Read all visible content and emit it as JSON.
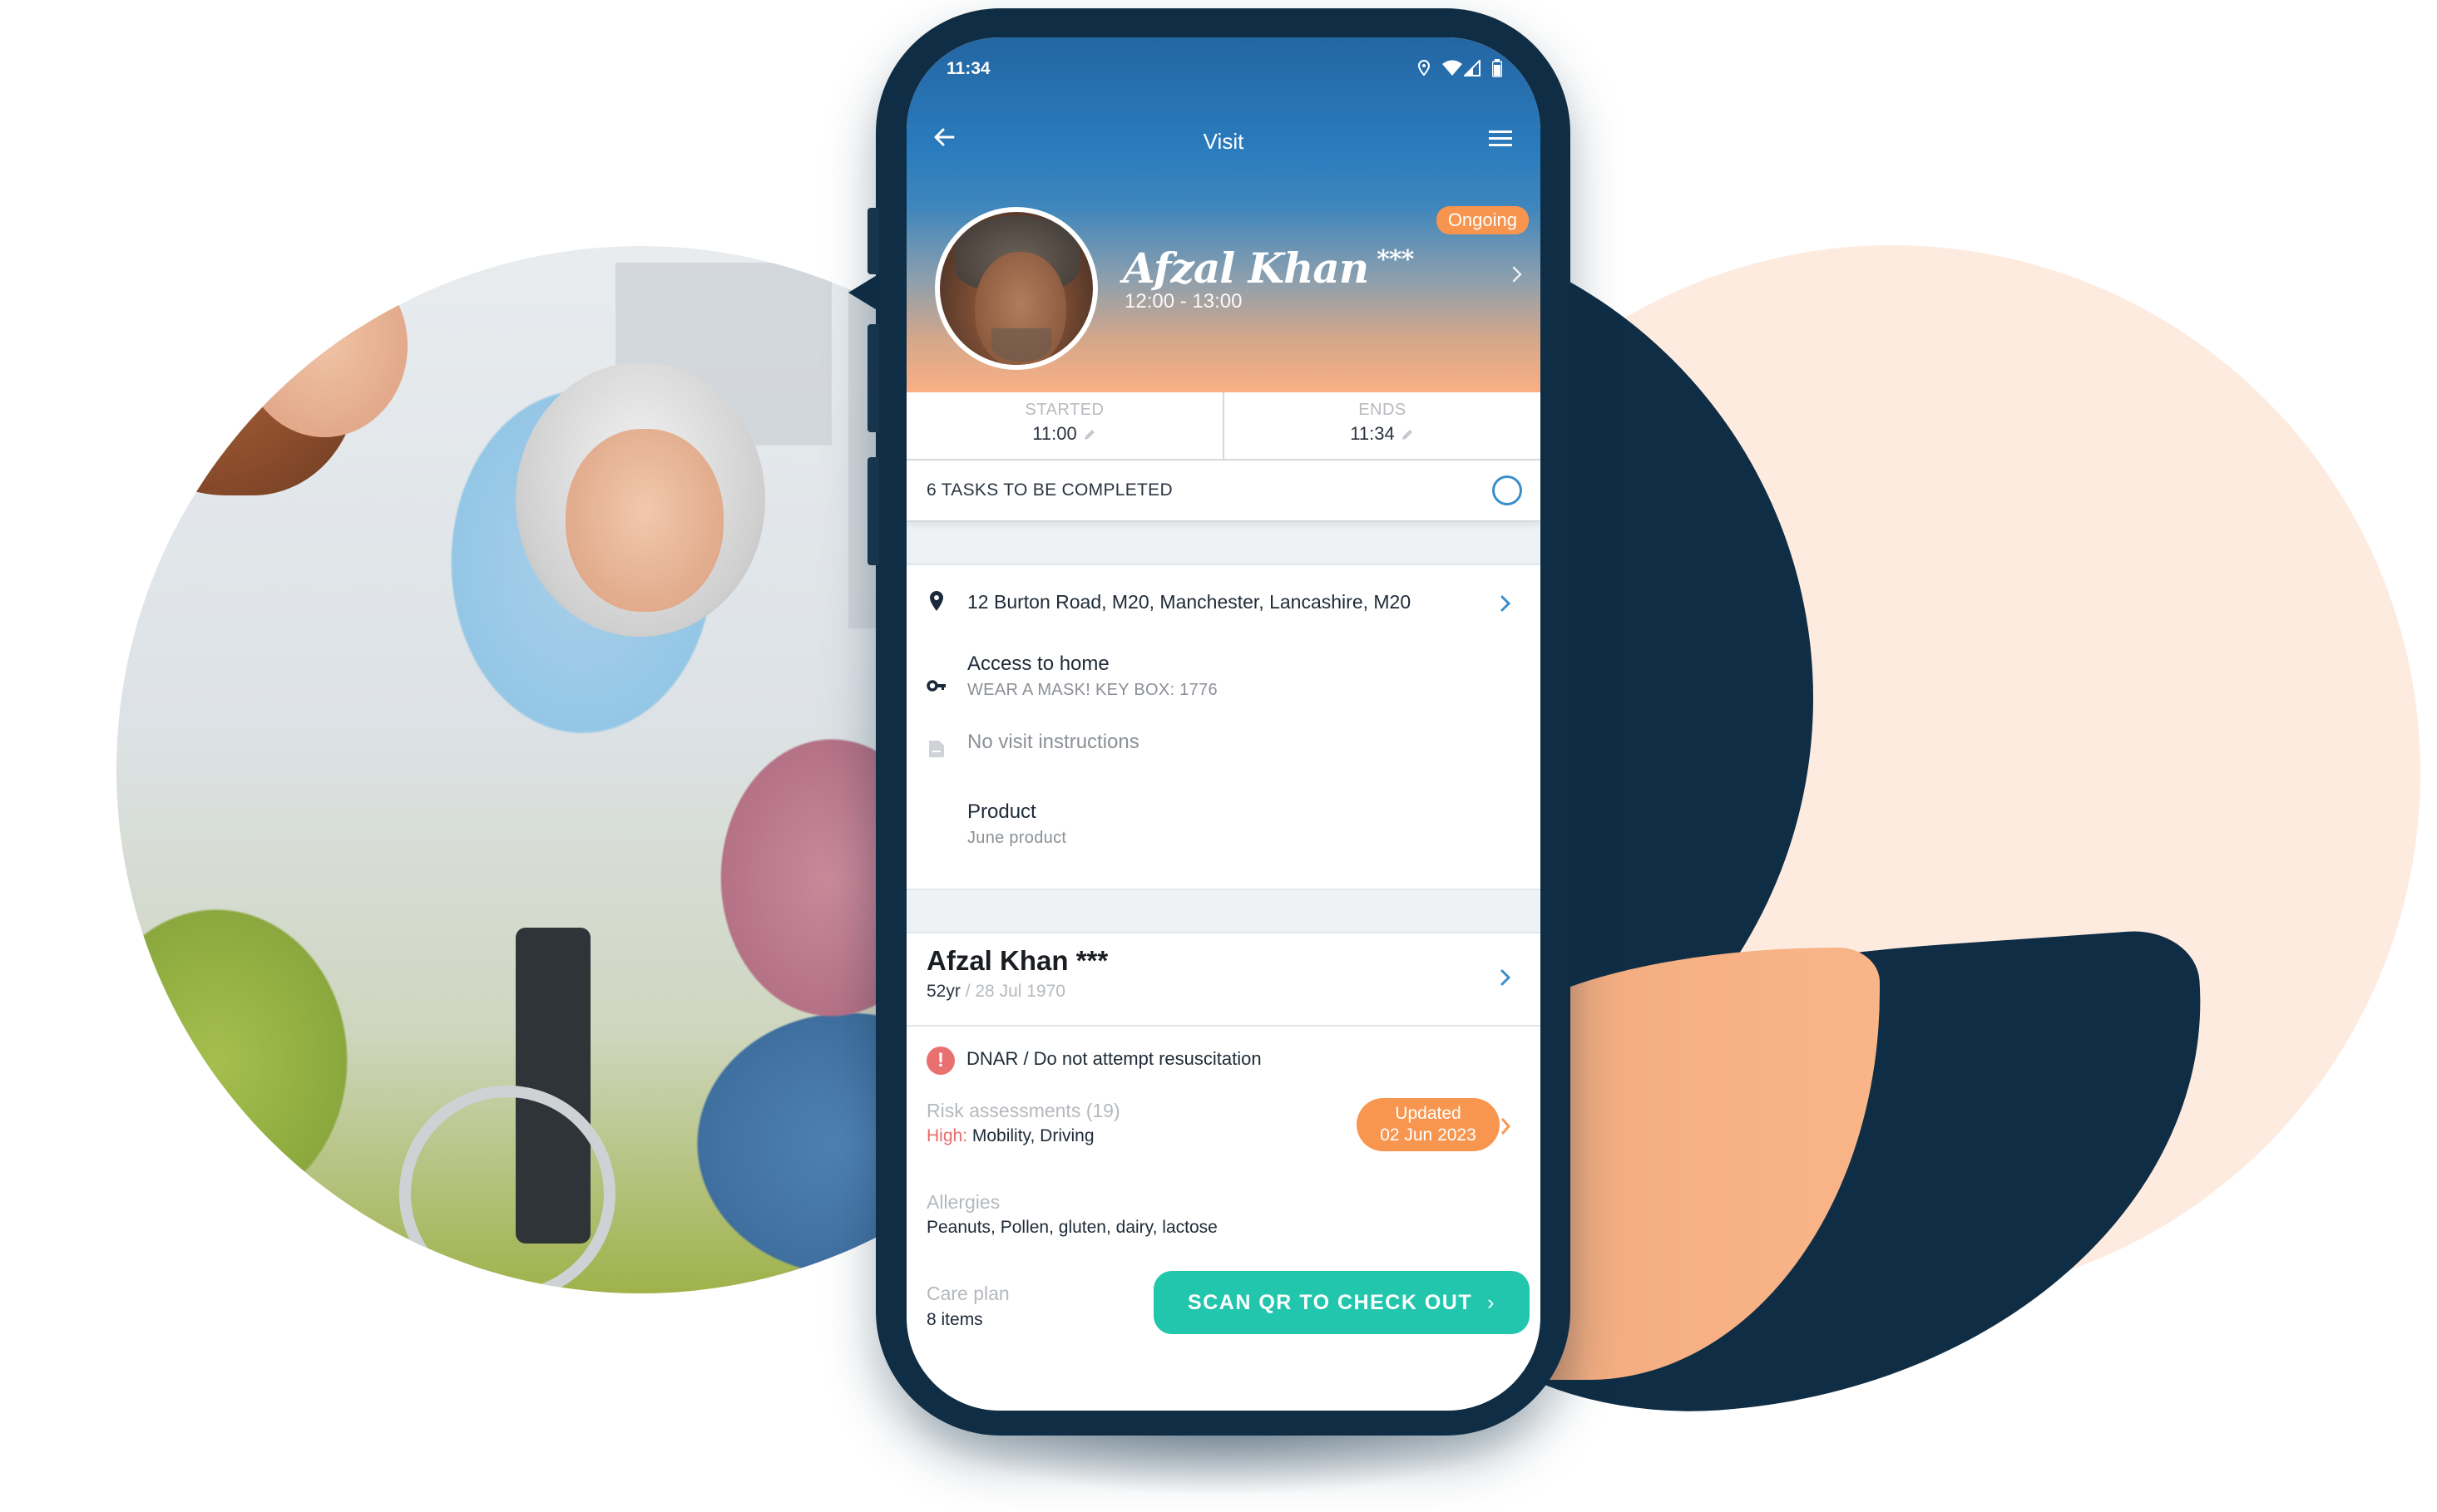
{
  "colors": {
    "navy": "#0f2d44",
    "peach_light": "#fdebe0",
    "peach": "#f9b587",
    "header_blue": "#2a7cbd",
    "header_orange": "#fbb084",
    "ongoing_orange": "#f7944d",
    "accent_blue": "#3a8fcb",
    "teal_button": "#22c6ad",
    "alert_red": "#e8716f"
  },
  "status_bar": {
    "time": "11:34",
    "icons": [
      "location-icon",
      "wifi-icon",
      "signal-icon",
      "battery-icon"
    ]
  },
  "nav": {
    "title": "Visit",
    "back_icon": "arrow-left-icon",
    "menu_icon": "hamburger-menu-icon"
  },
  "visit_header": {
    "patient_name": "Afzal Khan",
    "name_suffix": "***",
    "time_range": "12:00 - 13:00",
    "status": "Ongoing"
  },
  "times": {
    "started_label": "STARTED",
    "started_value": "11:00",
    "ends_label": "ENDS",
    "ends_value": "11:34"
  },
  "tasks": {
    "label": "6 TASKS TO BE COMPLETED"
  },
  "details": {
    "address": "12 Burton Road, M20, Manchester, Lancashire, M20",
    "access_title": "Access to home",
    "access_note": "WEAR A MASK! KEY BOX: 1776",
    "instructions": "No visit instructions",
    "product_title": "Product",
    "product_value": "June product"
  },
  "patient": {
    "name": "Afzal Khan",
    "name_suffix": "***",
    "age": "52yr",
    "dob": "28 Jul 1970",
    "dnar": "DNAR / Do not attempt resuscitation",
    "risk_title": "Risk assessments (19)",
    "risk_level_label": "High:",
    "risk_items": "Mobility, Driving",
    "risk_updated_label": "Updated",
    "risk_updated_date": "02 Jun 2023",
    "allergies_title": "Allergies",
    "allergies_list": "Peanuts, Pollen, gluten, dairy, lactose",
    "care_plan_title": "Care plan",
    "care_plan_count": "8 items"
  },
  "actions": {
    "scan_qr_label": "SCAN QR TO CHECK OUT",
    "scan_qr_chevron": "›"
  },
  "illustration": {
    "photo_subject": "caregiver with elderly woman in wheelchair"
  }
}
